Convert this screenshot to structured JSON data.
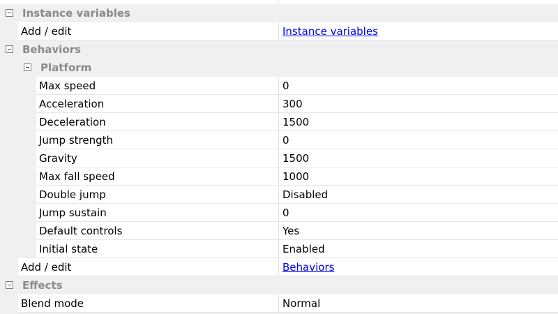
{
  "sections": {
    "instance_variables": {
      "title": "Instance variables",
      "add_edit_label": "Add / edit",
      "add_edit_link": "Instance variables"
    },
    "behaviors": {
      "title": "Behaviors",
      "platform": {
        "title": "Platform",
        "properties": [
          {
            "name": "Max speed",
            "value": "0"
          },
          {
            "name": "Acceleration",
            "value": "300"
          },
          {
            "name": "Deceleration",
            "value": "1500"
          },
          {
            "name": "Jump strength",
            "value": "0"
          },
          {
            "name": "Gravity",
            "value": "1500"
          },
          {
            "name": "Max fall speed",
            "value": "1000"
          },
          {
            "name": "Double jump",
            "value": "Disabled"
          },
          {
            "name": "Jump sustain",
            "value": "0"
          },
          {
            "name": "Default controls",
            "value": "Yes"
          },
          {
            "name": "Initial state",
            "value": "Enabled"
          }
        ]
      },
      "add_edit_label": "Add / edit",
      "add_edit_link": "Behaviors"
    },
    "effects": {
      "title": "Effects",
      "blend_mode_label": "Blend mode",
      "blend_mode_value": "Normal"
    }
  },
  "colors": {
    "link": "#0000e6",
    "section_text": "#8a8a8a",
    "background": "#f0f0f0",
    "cell": "#ffffff"
  }
}
